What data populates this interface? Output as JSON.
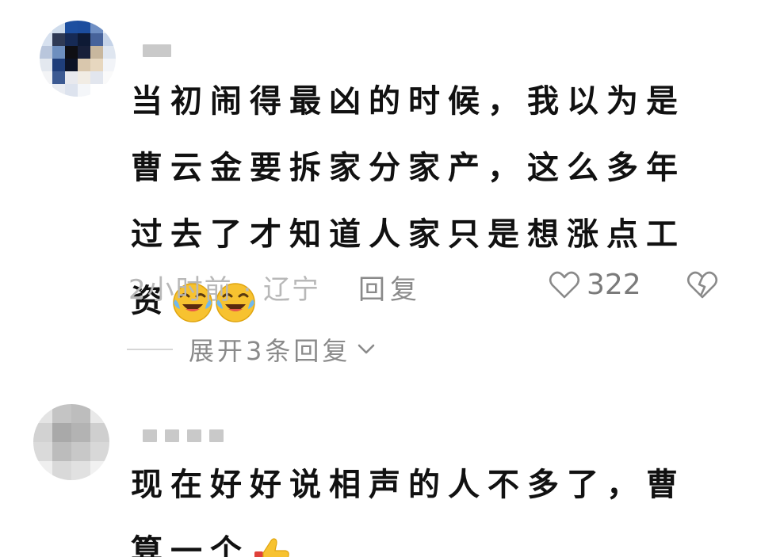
{
  "comments": [
    {
      "text": "当初闹得最凶的时候，我以为是曹云金要拆家分家产，这么多年过去了才知道人家只是想涨点工资",
      "emojis": [
        "laughing-crying-emoji",
        "laughing-crying-emoji"
      ],
      "meta": "2小时前 · 辽宁",
      "reply_label": "回复",
      "like_count": "322",
      "expand_replies": "展开3条回复"
    },
    {
      "text": "现在好好说相声的人不多了，曹算一个",
      "emojis": [
        "thumbs-up-emoji"
      ]
    }
  ],
  "colors": {
    "text": "#111111",
    "meta": "#b8b8b8",
    "action": "#8a8a8a",
    "username_placeholder": "#c9c9c9"
  }
}
